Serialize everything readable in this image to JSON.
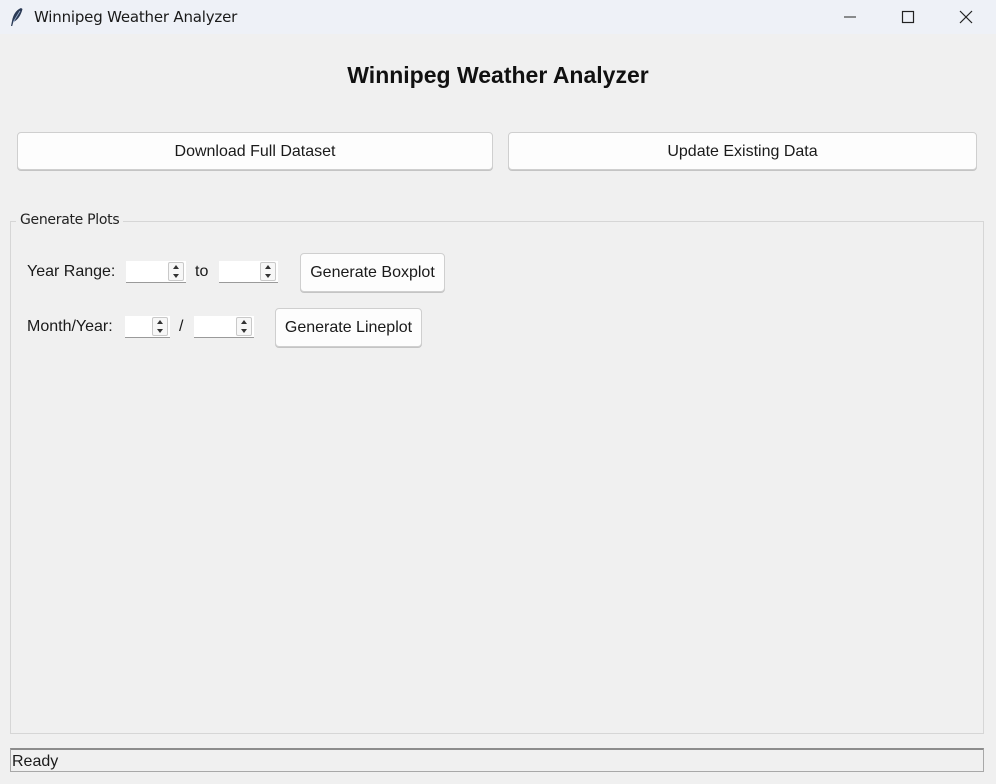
{
  "window": {
    "title": "Winnipeg Weather Analyzer",
    "icon": "feather-icon",
    "controls": [
      "minimize-icon",
      "maximize-icon",
      "close-icon"
    ]
  },
  "main": {
    "heading": "Winnipeg Weather Analyzer",
    "download_label": "Download Full Dataset",
    "update_label": "Update Existing Data"
  },
  "plots": {
    "group_label": "Generate Plots",
    "year_range_label": "Year Range:",
    "to_label": "to",
    "start_year_value": "",
    "end_year_value": "",
    "boxplot_label": "Generate Boxplot",
    "month_year_label": "Month/Year:",
    "slash_label": "/",
    "month_value": "",
    "year_value": "",
    "lineplot_label": "Generate Lineplot"
  },
  "status": {
    "text": "Ready"
  }
}
